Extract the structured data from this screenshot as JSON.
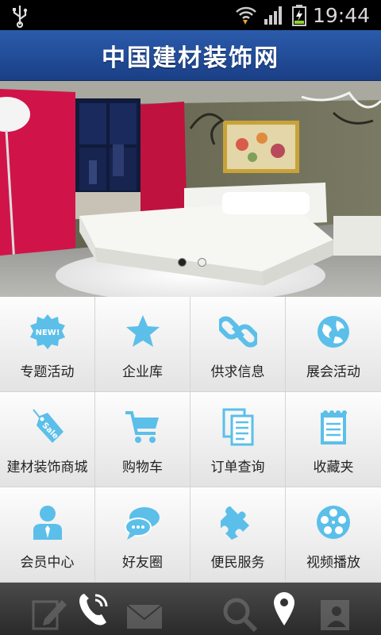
{
  "status_bar": {
    "time": "19:44",
    "icons": [
      "usb-icon",
      "wifi-icon",
      "signal-icon",
      "battery-charging-icon"
    ]
  },
  "header": {
    "title": "中国建材装饰网"
  },
  "banner": {
    "slide_count": 2,
    "active_slide": 1
  },
  "menu": [
    {
      "label": "专题活动",
      "icon": "new-badge-icon"
    },
    {
      "label": "企业库",
      "icon": "star-icon"
    },
    {
      "label": "供求信息",
      "icon": "link-icon"
    },
    {
      "label": "展会活动",
      "icon": "globe-icon"
    },
    {
      "label": "建材装饰商城",
      "icon": "sale-tag-icon"
    },
    {
      "label": "购物车",
      "icon": "cart-icon"
    },
    {
      "label": "订单查询",
      "icon": "documents-icon"
    },
    {
      "label": "收藏夹",
      "icon": "notepad-icon"
    },
    {
      "label": "会员中心",
      "icon": "user-icon"
    },
    {
      "label": "好友圈",
      "icon": "chat-bubbles-icon"
    },
    {
      "label": "便民服务",
      "icon": "puzzle-icon"
    },
    {
      "label": "视频播放",
      "icon": "film-reel-icon"
    }
  ],
  "bottom_bar": {
    "actions": [
      "phone-call-icon",
      "location-pin-icon"
    ]
  },
  "colors": {
    "header": "#1f4a96",
    "icon": "#5bbfe9",
    "bottom_bar": "#333333"
  }
}
